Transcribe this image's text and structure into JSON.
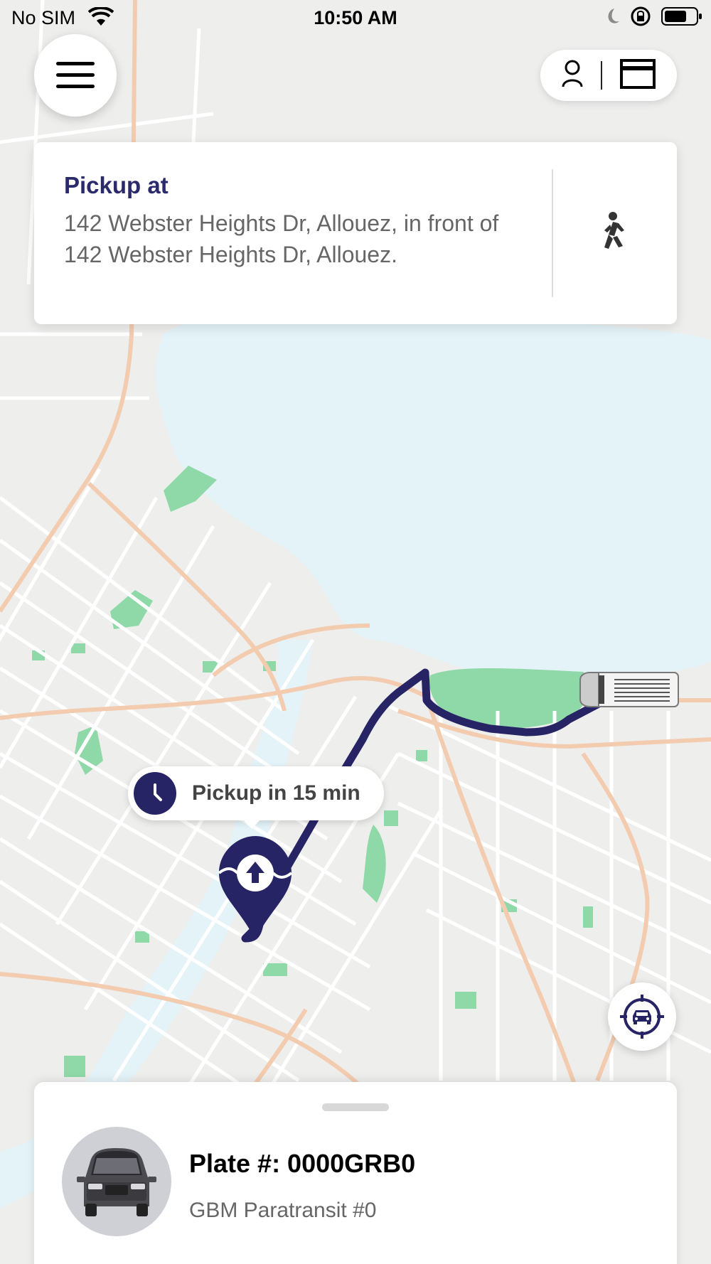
{
  "status_bar": {
    "carrier": "No SIM",
    "time": "10:50 AM",
    "icons": [
      "wifi-icon",
      "moon-icon",
      "orientation-lock-icon",
      "battery-icon"
    ]
  },
  "header": {
    "menu_icon": "hamburger-menu-icon",
    "pill_icons": [
      "person-icon",
      "wallet-card-icon"
    ]
  },
  "pickup": {
    "label": "Pickup at",
    "address": "142 Webster Heights Dr, Allouez, in front of 142 Webster Heights Dr, Allouez.",
    "icon": "walking-person-icon"
  },
  "map": {
    "eta_text": "Pickup in 15 min",
    "eta_icon": "clock-icon",
    "pickup_marker_icon": "pickup-arrow-marker-icon",
    "vehicle_marker_icon": "van-icon",
    "locate_icon": "locate-vehicle-icon",
    "route_color": "#272466",
    "water_color": "#e3f3f8",
    "park_color": "#8fd9a8"
  },
  "vehicle": {
    "plate": "Plate #: 0000GRB0",
    "name": "GBM Paratransit #0",
    "image_icon": "minivan-icon"
  },
  "colors": {
    "accent": "#272466"
  }
}
